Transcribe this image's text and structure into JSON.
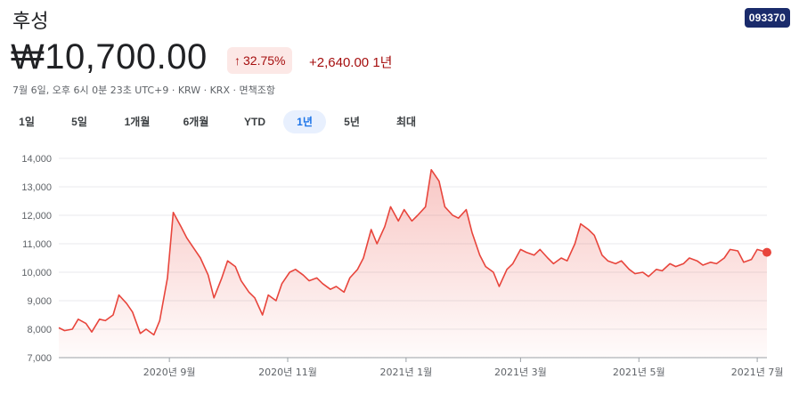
{
  "header": {
    "title": "후성",
    "ticker": "093370",
    "price": "₩10,700.00",
    "change_pct": "32.75%",
    "change_abs": "+2,640.00",
    "change_period": "1년",
    "meta": "7월 6일, 오후 6시 0분 23초 UTC+9 · KRW · KRX · 면책조항"
  },
  "colors": {
    "line": "#e8453c",
    "up": "#a50e0e",
    "tab_active": "#1a73e8"
  },
  "tabs": [
    {
      "label": "1일"
    },
    {
      "label": "5일"
    },
    {
      "label": "1개월"
    },
    {
      "label": "6개월"
    },
    {
      "label": "YTD"
    },
    {
      "label": "1년",
      "active": true
    },
    {
      "label": "5년"
    },
    {
      "label": "최대"
    }
  ],
  "chart_data": {
    "type": "area",
    "title": "",
    "xlabel": "",
    "ylabel": "",
    "ylim": [
      7000,
      14000
    ],
    "y_ticks": [
      7000,
      8000,
      9000,
      10000,
      11000,
      12000,
      13000,
      14000
    ],
    "y_tick_labels": [
      "7,000",
      "8,000",
      "9,000",
      "10,000",
      "11,000",
      "12,000",
      "13,000",
      "14,000"
    ],
    "xlim": [
      "2020-07-06",
      "2021-07-06"
    ],
    "x_ticks": [
      {
        "date": "2020-09-01",
        "label": "2020년 9월"
      },
      {
        "date": "2020-11-01",
        "label": "2020년 11월"
      },
      {
        "date": "2021-01-01",
        "label": "2021년 1월"
      },
      {
        "date": "2021-03-01",
        "label": "2021년 3월"
      },
      {
        "date": "2021-05-01",
        "label": "2021년 5월"
      },
      {
        "date": "2021-07-01",
        "label": "2021년 7월"
      }
    ],
    "grid": true,
    "series": [
      {
        "x": [
          "2020-07-06",
          "2020-07-09",
          "2020-07-13",
          "2020-07-16",
          "2020-07-20",
          "2020-07-23",
          "2020-07-27",
          "2020-07-30",
          "2020-08-03",
          "2020-08-06",
          "2020-08-10",
          "2020-08-13",
          "2020-08-17",
          "2020-08-20",
          "2020-08-24",
          "2020-08-27",
          "2020-08-31",
          "2020-09-03",
          "2020-09-07",
          "2020-09-10",
          "2020-09-14",
          "2020-09-17",
          "2020-09-21",
          "2020-09-24",
          "2020-09-28",
          "2020-10-01",
          "2020-10-05",
          "2020-10-08",
          "2020-10-12",
          "2020-10-15",
          "2020-10-19",
          "2020-10-22",
          "2020-10-26",
          "2020-10-29",
          "2020-11-02",
          "2020-11-05",
          "2020-11-09",
          "2020-11-12",
          "2020-11-16",
          "2020-11-19",
          "2020-11-23",
          "2020-11-26",
          "2020-11-30",
          "2020-12-03",
          "2020-12-07",
          "2020-12-10",
          "2020-12-14",
          "2020-12-17",
          "2020-12-21",
          "2020-12-24",
          "2020-12-28",
          "2020-12-31",
          "2021-01-04",
          "2021-01-07",
          "2021-01-11",
          "2021-01-14",
          "2021-01-18",
          "2021-01-21",
          "2021-01-25",
          "2021-01-28",
          "2021-02-01",
          "2021-02-04",
          "2021-02-08",
          "2021-02-11",
          "2021-02-15",
          "2021-02-18",
          "2021-02-22",
          "2021-02-25",
          "2021-03-01",
          "2021-03-04",
          "2021-03-08",
          "2021-03-11",
          "2021-03-15",
          "2021-03-18",
          "2021-03-22",
          "2021-03-25",
          "2021-03-29",
          "2021-04-01",
          "2021-04-05",
          "2021-04-08",
          "2021-04-12",
          "2021-04-15",
          "2021-04-19",
          "2021-04-22",
          "2021-04-26",
          "2021-04-29",
          "2021-05-03",
          "2021-05-06",
          "2021-05-10",
          "2021-05-13",
          "2021-05-17",
          "2021-05-20",
          "2021-05-24",
          "2021-05-27",
          "2021-05-31",
          "2021-06-03",
          "2021-06-07",
          "2021-06-10",
          "2021-06-14",
          "2021-06-17",
          "2021-06-21",
          "2021-06-24",
          "2021-06-28",
          "2021-07-01",
          "2021-07-06"
        ],
        "values": [
          8050,
          7950,
          8000,
          8350,
          8200,
          7900,
          8350,
          8300,
          8500,
          9200,
          8900,
          8600,
          7850,
          8000,
          7800,
          8300,
          9800,
          12100,
          11600,
          11200,
          10800,
          10500,
          9900,
          9100,
          9800,
          10400,
          10200,
          9700,
          9300,
          9100,
          8500,
          9200,
          9000,
          9600,
          10000,
          10100,
          9900,
          9700,
          9800,
          9600,
          9400,
          9500,
          9300,
          9800,
          10100,
          10500,
          11500,
          11000,
          11600,
          12300,
          11800,
          12200,
          11800,
          12000,
          12300,
          13600,
          13200,
          12300,
          12000,
          11900,
          12200,
          11400,
          10600,
          10200,
          10000,
          9500,
          10100,
          10300,
          10800,
          10700,
          10600,
          10800,
          10500,
          10300,
          10500,
          10400,
          11000,
          11700,
          11500,
          11300,
          10600,
          10400,
          10300,
          10400,
          10100,
          9950,
          10000,
          9850,
          10100,
          10050,
          10300,
          10200,
          10300,
          10500,
          10400,
          10250,
          10350,
          10300,
          10500,
          10800,
          10750,
          10350,
          10450,
          10800,
          10700
        ]
      }
    ]
  }
}
